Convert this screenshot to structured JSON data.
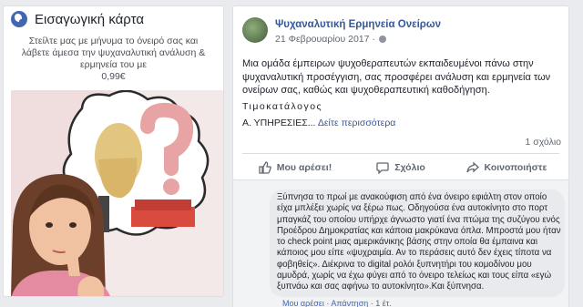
{
  "left_card": {
    "title": "Εισαγωγική κάρτα",
    "promo": "Στείλτε μας με μήνυμα το όνειρό σας και λάβετε άμεσα την ψυχαναλυτική ανάλυση & ερμηνεία του με",
    "price": "0,99€"
  },
  "post": {
    "page_name": "Ψυχαναλυτική Ερμηνεία Ονείρων",
    "date": "21 Φεβρουαρίου 2017 ·",
    "body": "Μια ομάδα έμπειρων ψυχοθεραπευτών εκπαιδευμένοι πάνω στην ψυχαναλυτική προσέγγιση, σας προσφέρει ανάλυση και ερμηνεία των ονείρων σας, καθώς και ψυχοθεραπευτική καθοδήγηση.",
    "line_t": "Τιμοκατάλογος",
    "line_a": "Α. ΥΠΗΡΕΣΙΕΣ...",
    "see_more": "Δείτε περισσότερα",
    "comments_count": "1 σχόλιο",
    "actions": {
      "like": "Μου αρέσει!",
      "comment": "Σχόλιο",
      "share": "Κοινοποιήστε"
    }
  },
  "comment": {
    "text": "Ξύπνησα το πρωί με ανακούφιση από ένα όνειρο εφιάλτη στον οποίο είχα μπλέξει χωρίς να ξέρω πως. Οδηγούσα ένα αυτοκίνητο στο πορτ μπαγκάζ του οποίου υπήρχε άγνωστο γιατί ένα πτώμα της συζύγου ενός Προέδρου Δημοκρατίας και κάποια μακρύκανα όπλα. Μπροστά μου ήταν το check point μιας αμερικάνικης βάσης στην οποία θα έμπαινα και κάποιος μου είπε «ψυχραιμία. Αν το περάσεις αυτό δεν έχεις τίποτα να φοβηθείς». Διέκρινα το digital ρολόι ξυπνητήρι του κομοδίνου μου αμυδρά, χωρίς να έχω φύγει από το όνειρο τελείως και τους είπα «εγώ ξυπνάω και σας αφήνω το αυτοκίνητο».Και ξύπνησα.",
    "meta_like": "Μου αρέσει",
    "meta_reply": "Απάντηση",
    "meta_time": "1 έτ."
  },
  "colors": {
    "link": "#365899",
    "accent": "#4267b2",
    "background": "#e9ebee"
  },
  "icons": [
    "globe-icon",
    "thumbs-up-icon",
    "comment-icon",
    "share-icon"
  ]
}
